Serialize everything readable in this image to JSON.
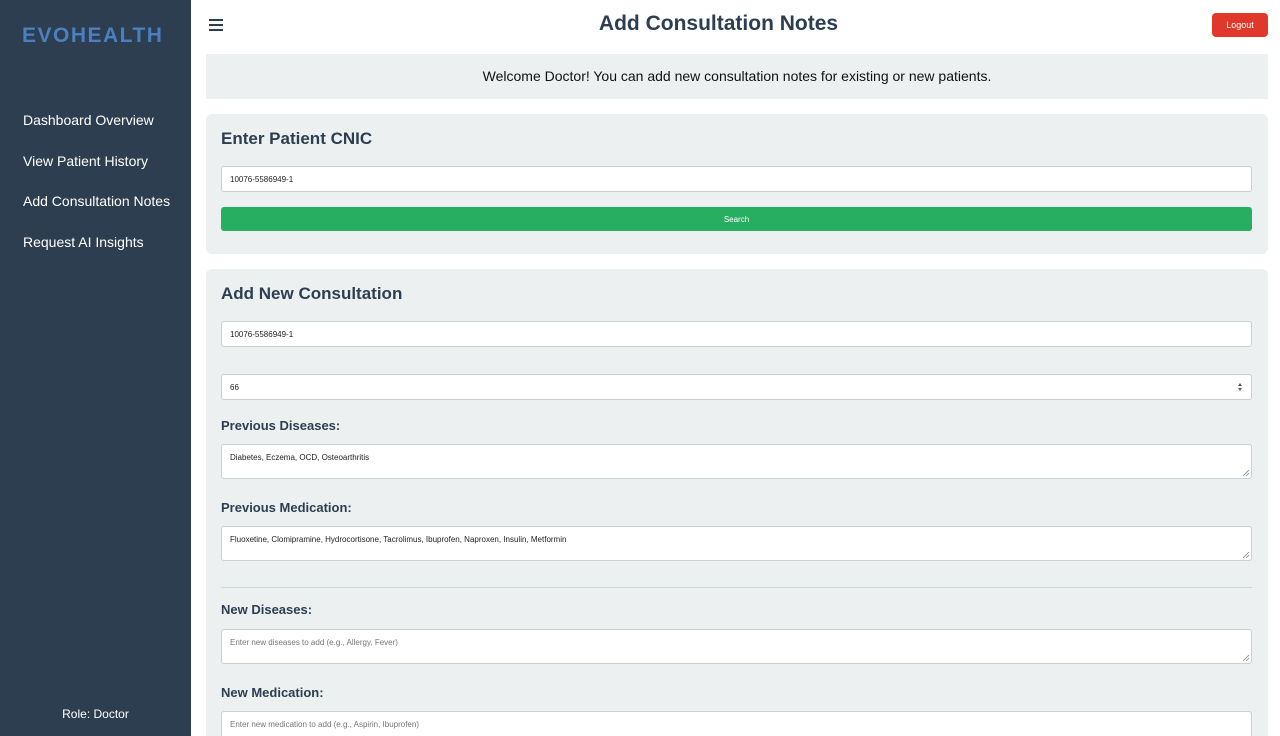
{
  "brand": {
    "logo_text": "EVOHEALTH",
    "logo_color": "#4a7fc1"
  },
  "sidebar": {
    "items": [
      {
        "label": "Dashboard Overview"
      },
      {
        "label": "View Patient History"
      },
      {
        "label": "Add Consultation Notes"
      },
      {
        "label": "Request AI Insights"
      }
    ],
    "role_text": "Role: Doctor"
  },
  "header": {
    "title": "Add Consultation Notes",
    "logout_label": "Logout",
    "menu_icon": "hamburger-icon"
  },
  "welcome_text": "Welcome Doctor! You can add new consultation notes for existing or new patients.",
  "cnic_section": {
    "title": "Enter Patient CNIC",
    "cnic_value": "10076-5586949-1",
    "search_label": "Search"
  },
  "consult_section": {
    "title": "Add New Consultation",
    "cnic_value": "10076-5586949-1",
    "age_value": "66",
    "previous_diseases_label": "Previous Diseases:",
    "previous_diseases_value": "Diabetes, Eczema, OCD, Osteoarthritis",
    "previous_medication_label": "Previous Medication:",
    "previous_medication_value": "Fluoxetine, Clomipramine, Hydrocortisone, Tacrolimus, Ibuprofen, Naproxen, Insulin, Metformin",
    "new_diseases_label": "New Diseases:",
    "new_diseases_placeholder": "Enter new diseases to add (e.g., Allergy, Fever)",
    "new_medication_label": "New Medication:",
    "new_medication_placeholder": "Enter new medication to add (e.g., Aspirin, Ibuprofen)"
  },
  "colors": {
    "sidebar_bg": "#2c3e50",
    "logout_bg": "#e0392b",
    "search_bg": "#27ae60",
    "card_bg": "#ecf0f1"
  }
}
